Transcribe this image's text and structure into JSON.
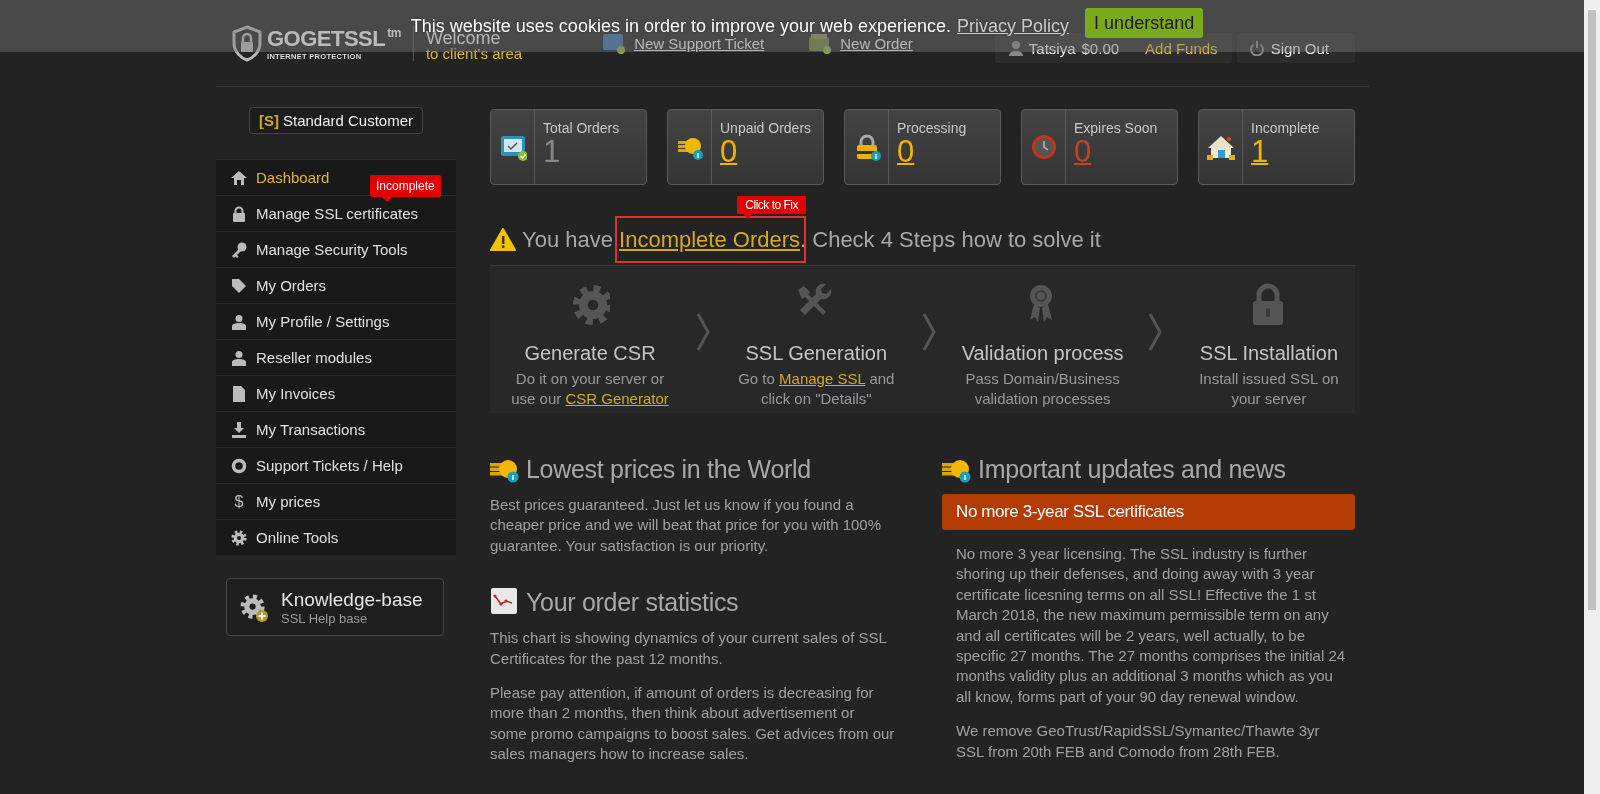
{
  "cookie_banner": {
    "text": "This website uses cookies in order to improve your web experience.",
    "link": "Privacy Policy",
    "button": "I understand"
  },
  "header": {
    "logo": {
      "name": "GOGETSSL",
      "mark": "tm",
      "tagline": "INTERNET PROTECTION"
    },
    "welcome_title": "Welcome",
    "welcome_subtitle": "to client's area",
    "links": [
      {
        "label": "New Support Ticket"
      },
      {
        "label": "New Order"
      }
    ],
    "account": {
      "user": "Tatsiya",
      "balance": "$0.00",
      "add_funds": "Add Funds"
    },
    "sign_out": "Sign Out"
  },
  "sidebar": {
    "customer_badge": {
      "tag": "[S]",
      "label": "Standard Customer"
    },
    "items": [
      {
        "label": "Dashboard",
        "selected": true
      },
      {
        "label": "Manage SSL certificates",
        "selected": false
      },
      {
        "label": "Manage Security Tools",
        "selected": false
      },
      {
        "label": "My Orders",
        "selected": false
      },
      {
        "label": "My Profile / Settings",
        "selected": false
      },
      {
        "label": "Reseller modules",
        "selected": false
      },
      {
        "label": "My Invoices",
        "selected": false
      },
      {
        "label": "My Transactions",
        "selected": false
      },
      {
        "label": "Support Tickets / Help",
        "selected": false
      },
      {
        "label": "My prices",
        "selected": false,
        "glyph": "$"
      },
      {
        "label": "Online Tools",
        "selected": false
      }
    ],
    "callout": "Incomplete",
    "knowledge_base": {
      "title": "Knowledge-base",
      "subtitle": "SSL Help base"
    }
  },
  "stats": [
    {
      "label": "Total Orders",
      "value": "1",
      "kind": "plain"
    },
    {
      "label": "Unpaid Orders",
      "value": "0",
      "kind": "link"
    },
    {
      "label": "Processing",
      "value": "0",
      "kind": "link"
    },
    {
      "label": "Expires Soon",
      "value": "0",
      "kind": "alert"
    },
    {
      "label": "Incomplete",
      "value": "1",
      "kind": "link"
    }
  ],
  "alert": {
    "before": "You have ",
    "link": "Incomplete Orders",
    "after": ". Check 4 Steps how to solve it",
    "callout": "Click to Fix"
  },
  "steps": [
    {
      "title": "Generate CSR",
      "before": "Do it on your server or use our ",
      "link": "CSR Generator"
    },
    {
      "title": "SSL Generation",
      "before": "Go to ",
      "link": "Manage SSL",
      "after": " and click on \"Details\""
    },
    {
      "title": "Validation process",
      "before": "Pass Domain/Business validation processes"
    },
    {
      "title": "SSL Installation",
      "before": "Install issued SSL on your server"
    }
  ],
  "left_sections": [
    {
      "title": "Lowest prices in the World",
      "paragraphs": [
        "Best prices guaranteed. Just let us know if you found a cheaper price and we will beat that price for you with 100% guarantee. Your satisfaction is our priority."
      ]
    },
    {
      "title": "Your order statistics",
      "paragraphs": [
        "This chart is showing dynamics of your current sales of SSL Certificates for the past 12 months.",
        "Please pay attention, if amount of orders is decreasing for more than 2 months, then think about advertisement or some promo campaigns to boost sales. Get advices from our sales managers how to increase sales."
      ]
    }
  ],
  "news": {
    "title": "Important updates and news",
    "notice": "No more 3-year SSL certificates",
    "paragraphs": [
      "No more 3 year licensing. The SSL industry is further shoring up their defenses, and doing away with 3 year certificate licesning terms on all SSL! Effective the 1 st March 2018, the new maximum permissible term on any and all certificates will be 2 years, well actually, to be specific 27 months. The 27 months comprises the initial 24 months validity plus an additional 3 months which as you all know, forms part of your 90 day renewal window.",
      "We remove GeoTrust/RapidSSL/Symantec/Thawte 3yr SSL from 20th FEB and Comodo from 28th FEB."
    ]
  }
}
